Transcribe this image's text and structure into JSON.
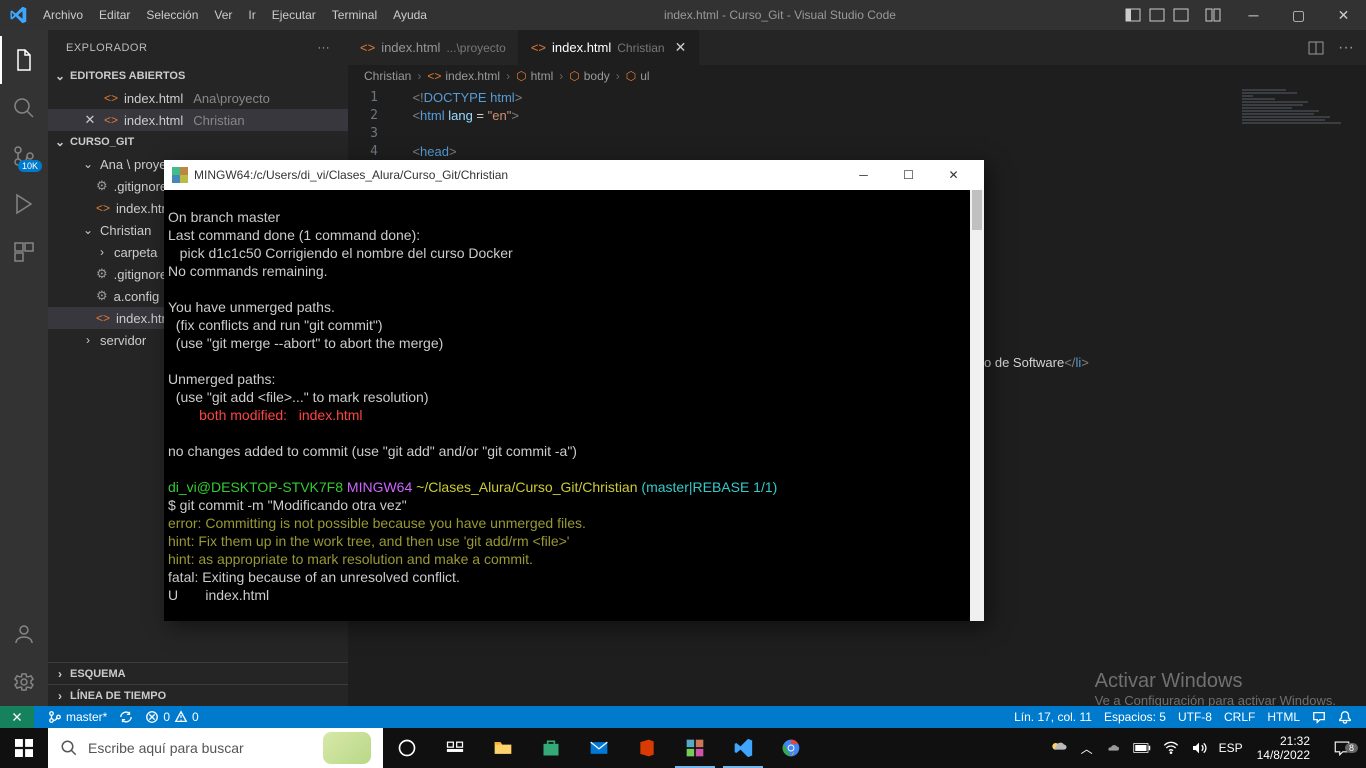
{
  "titlebar": {
    "menu": [
      "Archivo",
      "Editar",
      "Selección",
      "Ver",
      "Ir",
      "Ejecutar",
      "Terminal",
      "Ayuda"
    ],
    "title": "index.html - Curso_Git - Visual Studio Code"
  },
  "activity": {
    "badge_10k": "10K"
  },
  "sidebar": {
    "title": "EXPLORADOR",
    "open_editors": "EDITORES ABIERTOS",
    "oe1_file": "index.html",
    "oe1_path": "Ana\\proyecto",
    "oe2_file": "index.html",
    "oe2_path": "Christian",
    "project": "CURSO_GIT",
    "tree": {
      "ana": "Ana \\ proyecto",
      "gitignore1": ".gitignore",
      "idx1": "index.html",
      "christian": "Christian",
      "carpeta": "carpeta",
      "gitignore2": ".gitignore",
      "aconfig": "a.config",
      "idx2": "index.html",
      "servidor": "servidor"
    },
    "esquema": "ESQUEMA",
    "timeline": "LÍNEA DE TIEMPO"
  },
  "tabs": {
    "t1_name": "index.html",
    "t1_path": "...\\proyecto",
    "t2_name": "index.html",
    "t2_path": "Christian"
  },
  "breadcrumb": {
    "p1": "Christian",
    "p2": "index.html",
    "p3": "html",
    "p4": "body",
    "p5": "ul"
  },
  "code": {
    "l1a": "<!",
    "l1b": "DOCTYPE ",
    "l1c": "html",
    "l1d": ">",
    "l2a": "<",
    "l2b": "html ",
    "l2c": "lang ",
    "l2d": "= ",
    "l2e": "\"en\"",
    "l2f": ">",
    "l4a": "<",
    "l4b": "head",
    "l4c": ">",
    "peek": "o de Software",
    "peek_close": "li"
  },
  "terminal": {
    "title": "MINGW64:/c/Users/di_vi/Clases_Alura/Curso_Git/Christian",
    "lines": {
      "l1": "On branch master",
      "l2": "Last command done (1 command done):",
      "l3": "   pick d1c1c50 Corrigiendo el nombre del curso Docker",
      "l4": "No commands remaining.",
      "l5": "",
      "l6": "You have unmerged paths.",
      "l7": "  (fix conflicts and run \"git commit\")",
      "l8": "  (use \"git merge --abort\" to abort the merge)",
      "l9": "",
      "l10": "Unmerged paths:",
      "l11": "  (use \"git add <file>...\" to mark resolution)",
      "l12a": "        both modified:   ",
      "l12b": "index.html",
      "l13": "",
      "l14": "no changes added to commit (use \"git add\" and/or \"git commit -a\")",
      "l15": "",
      "p1_user": "di_vi@DESKTOP-STVK7F8 ",
      "p1_host": "MINGW64 ",
      "p1_path": "~/Clases_Alura/Curso_Git/Christian ",
      "p1_branch": "(master|REBASE 1/1)",
      "l16": "$ git commit -m \"Modificando otra vez\"",
      "l17": "error: Committing is not possible because you have unmerged files.",
      "l18": "hint: Fix them up in the work tree, and then use 'git add/rm <file>'",
      "l19": "hint: as appropriate to mark resolution and make a commit.",
      "l20": "fatal: Exiting because of an unresolved conflict.",
      "l21": "U       index.html",
      "l22": "",
      "l23": "$"
    }
  },
  "statusbar": {
    "branch": "master*",
    "sync": "",
    "errors": "0",
    "warns": "0",
    "ln": "Lín. 17, col. 11",
    "spaces": "Espacios: 5",
    "encoding": "UTF-8",
    "eol": "CRLF",
    "lang": "HTML"
  },
  "watermark": {
    "l1": "Activar Windows",
    "l2": "Ve a Configuración para activar Windows."
  },
  "taskbar": {
    "search_placeholder": "Escribe aquí para buscar",
    "lang": "ESP",
    "time": "21:32",
    "date": "14/8/2022",
    "notif": "8"
  }
}
